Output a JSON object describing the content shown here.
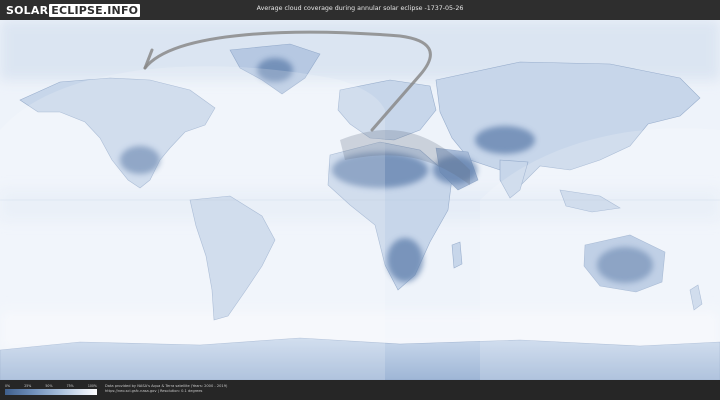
{
  "header": {
    "logo_part1": "SOLAR",
    "logo_part2": "ECLIPSE.INFO",
    "title": "Average cloud coverage during annular solar eclipse -1737-05-26"
  },
  "map": {
    "background_color": "#eef3fa",
    "land_outline_color": "#7f98bd",
    "eclipse_path_color": "#8a8a8a",
    "penumbra_shade_color": "#ffffff"
  },
  "legend": {
    "ticks": [
      "0%",
      "25%",
      "50%",
      "75%",
      "100%"
    ],
    "gradient_start": "#3f5f8c",
    "gradient_end": "#ffffff"
  },
  "footer": {
    "credit_line1": "Data provided by NASA's Aqua & Terra satellite (Years: 2000 - 2019)",
    "credit_line2": "https://neo.sci.gsfc.nasa.gov | Resolution: 0.1 degrees"
  }
}
